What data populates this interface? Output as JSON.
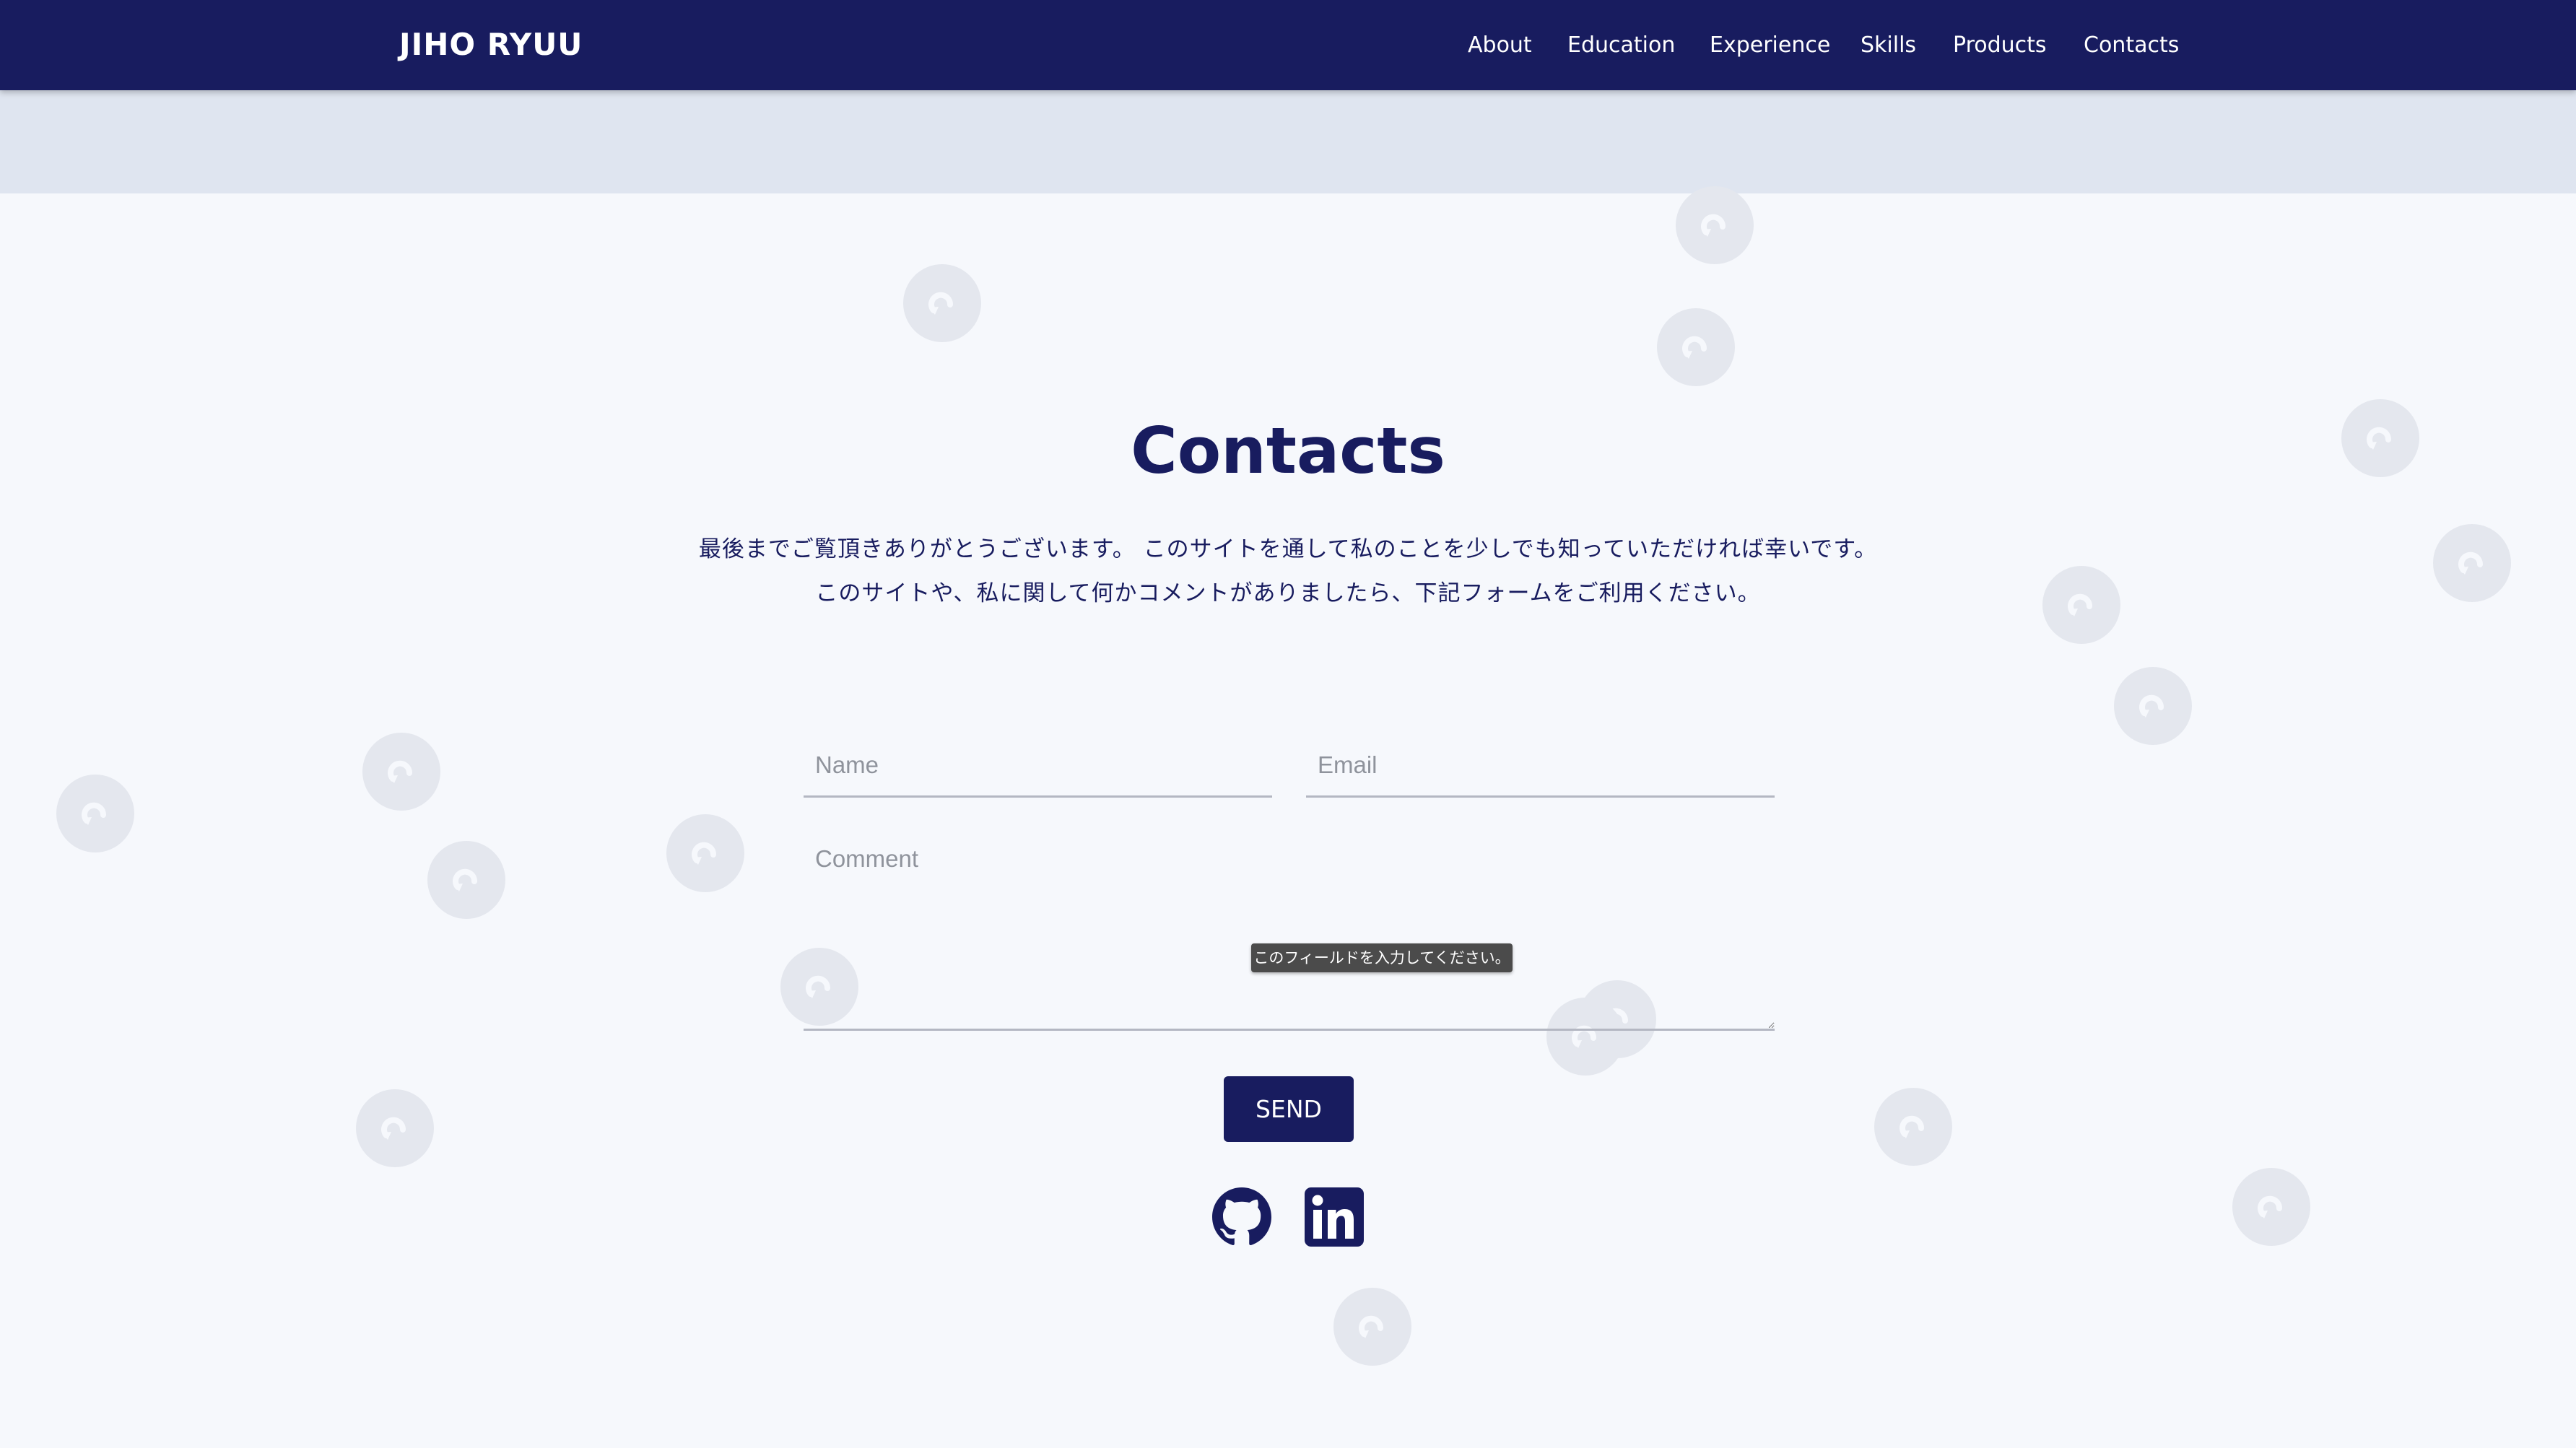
{
  "nav": {
    "brand": "JIHO RYUU",
    "links": [
      "About",
      "Education",
      "Experience",
      "Skills",
      "Products",
      "Contacts"
    ]
  },
  "contacts": {
    "title": "Contacts",
    "message_line1": "最後までご覧頂きありがとうございます。 このサイトを通して私のことを少しでも知っていただければ幸いです。",
    "message_line2": "このサイトや、私に関して何かコメントがありましたら、下記フォームをご利用ください。"
  },
  "form": {
    "name_placeholder": "Name",
    "email_placeholder": "Email",
    "comment_placeholder": "Comment",
    "validation_tooltip": "このフィールドを入力してください。",
    "send_label": "SEND"
  },
  "social": {
    "icons": [
      "github-icon",
      "linkedin-icon"
    ]
  },
  "colors": {
    "primary": "#181c5f",
    "band": "#dfe5f0",
    "background": "#f6f8fc",
    "bubble": "#e4e7ee"
  }
}
